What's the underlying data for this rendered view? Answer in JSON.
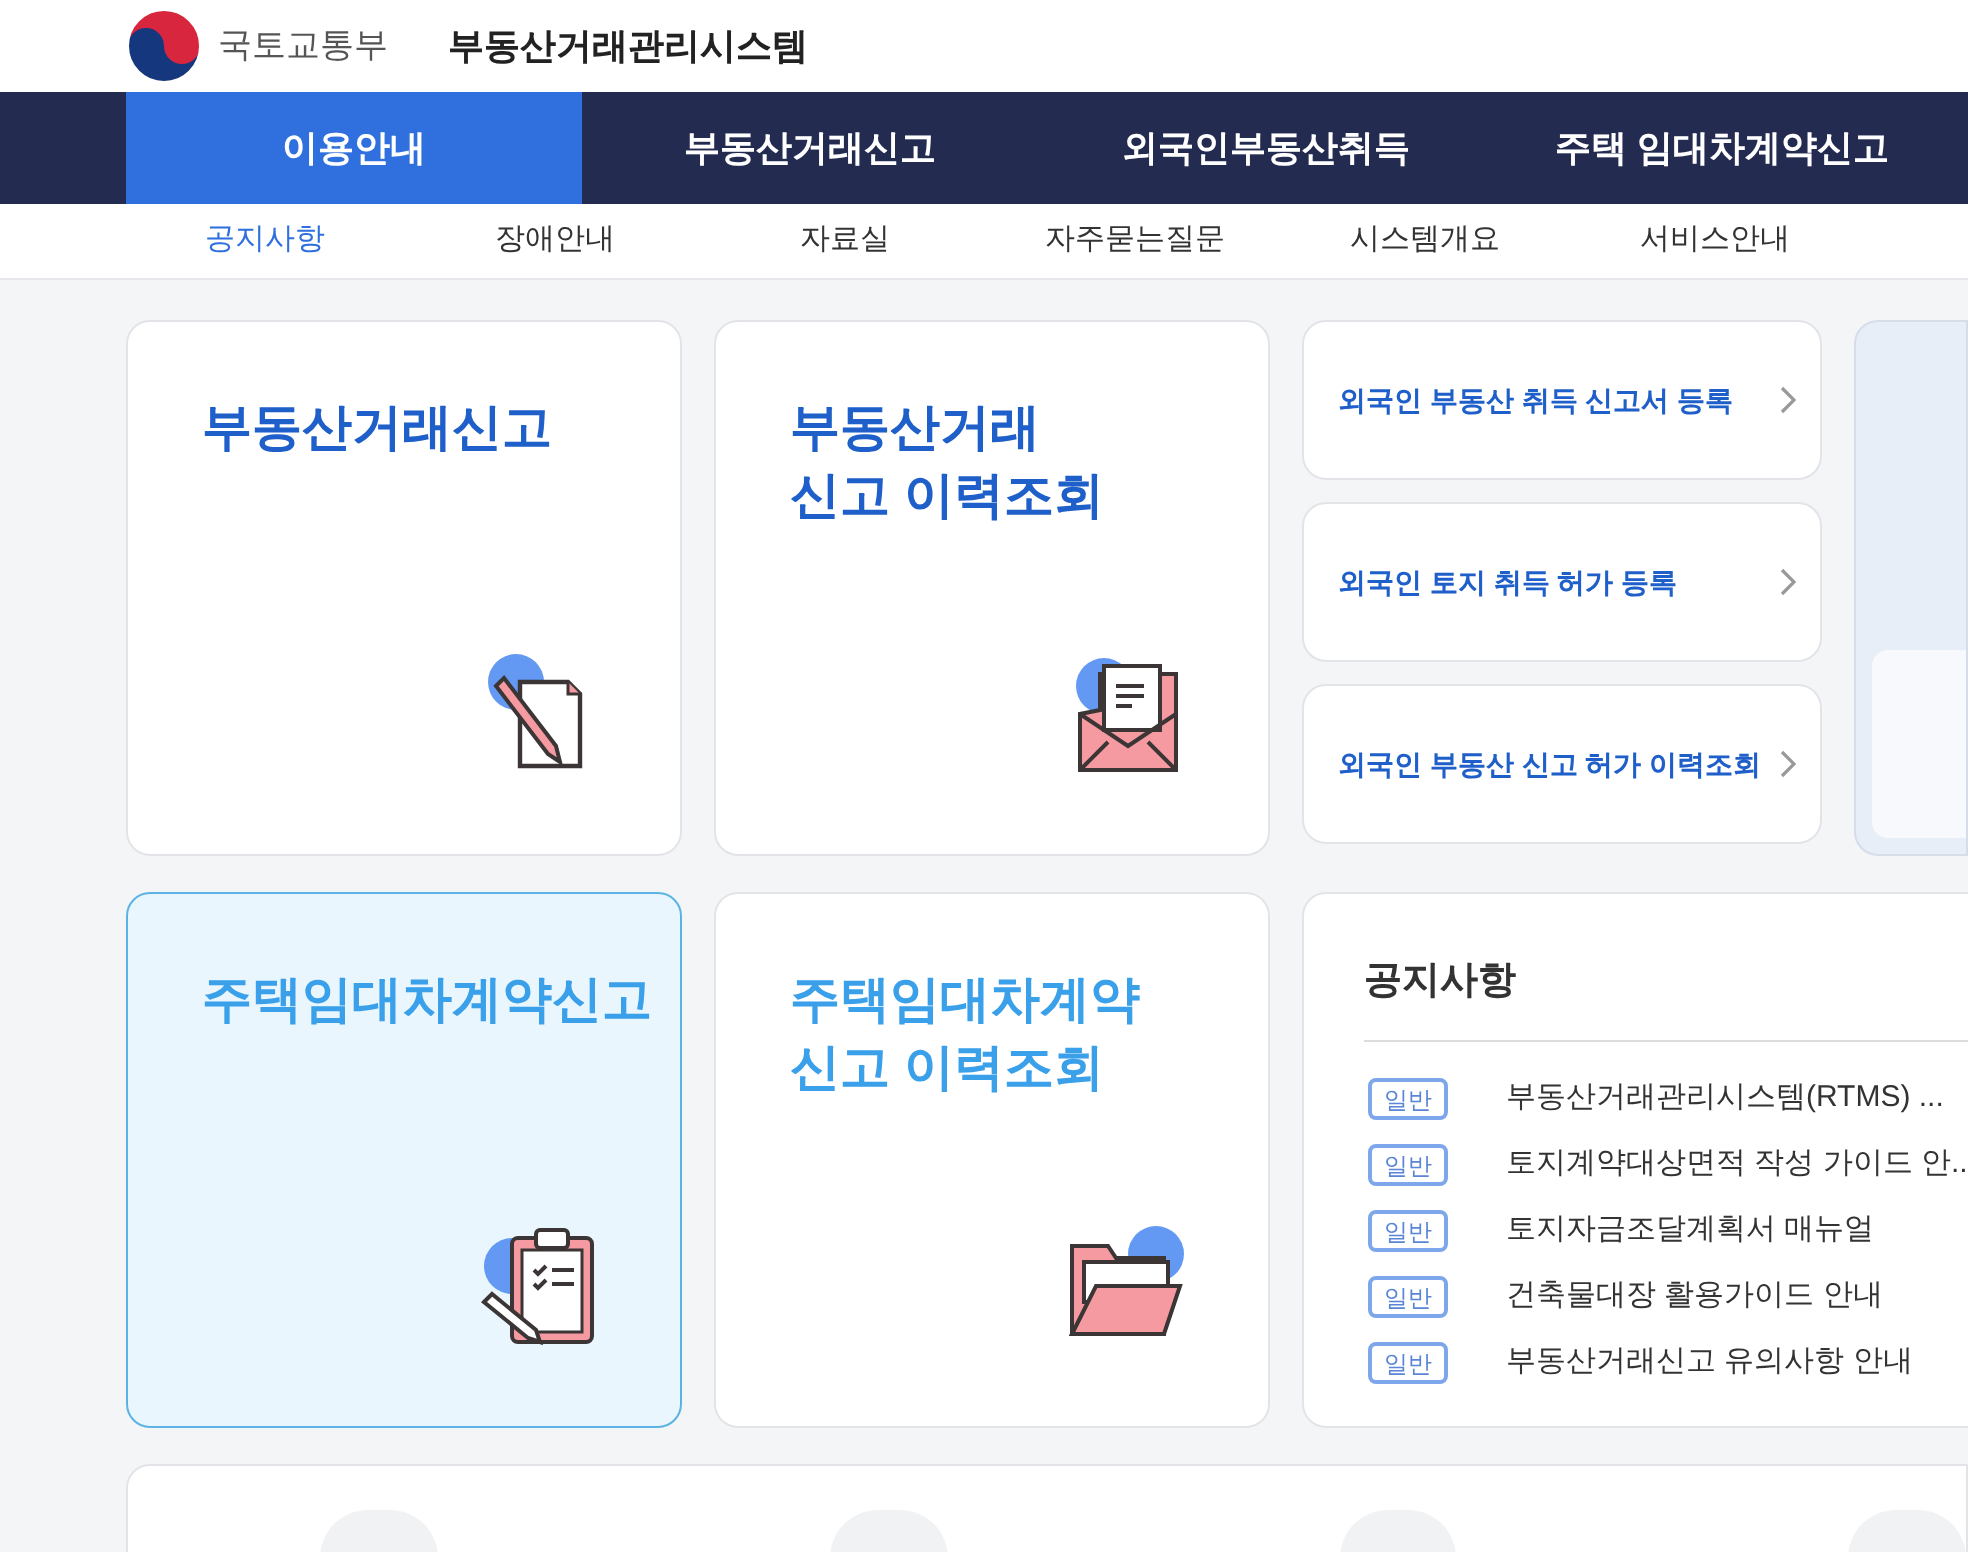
{
  "header": {
    "ministry": "국토교통부",
    "system_title": "부동산거래관리시스템"
  },
  "nav_tabs": [
    {
      "label": "이용안내",
      "selected": true
    },
    {
      "label": "부동산거래신고",
      "selected": false
    },
    {
      "label": "외국인부동산취득",
      "selected": false
    },
    {
      "label": "주택 임대차계약신고",
      "selected": false
    }
  ],
  "sub_nav": [
    {
      "label": "공지사항",
      "selected": true
    },
    {
      "label": "장애안내",
      "selected": false
    },
    {
      "label": "자료실",
      "selected": false
    },
    {
      "label": "자주묻는질문",
      "selected": false
    },
    {
      "label": "시스템개요",
      "selected": false
    },
    {
      "label": "서비스안내",
      "selected": false
    }
  ],
  "tiles": [
    {
      "title": "부동산거래신고",
      "kind": "write",
      "selected": false,
      "color": "#1f5fc9"
    },
    {
      "title": "부동산거래\n신고 이력조회",
      "kind": "mail",
      "selected": false,
      "color": "#1f5fc9"
    },
    {
      "title": "주택임대차계약신고",
      "kind": "clipboard",
      "selected": true,
      "color": "#3aa0ea"
    },
    {
      "title": "주택임대차계약\n신고 이력조회",
      "kind": "folder",
      "selected": false,
      "color": "#3aa0ea"
    }
  ],
  "foreign_links": [
    "외국인 부동산 취득 신고서 등록",
    "외국인 토지 취득 허가 등록",
    "외국인 부동산 신고 허가 이력조회"
  ],
  "notices": {
    "title": "공지사항",
    "items": [
      {
        "tag": "일반",
        "text": "부동산거래관리시스템(RTMS) ..."
      },
      {
        "tag": "일반",
        "text": "토지계약대상면적 작성 가이드 안..."
      },
      {
        "tag": "일반",
        "text": "토지자금조달계획서 매뉴얼"
      },
      {
        "tag": "일반",
        "text": "건축물대장 활용가이드 안내"
      },
      {
        "tag": "일반",
        "text": "부동산거래신고 유의사항 안내"
      }
    ]
  }
}
